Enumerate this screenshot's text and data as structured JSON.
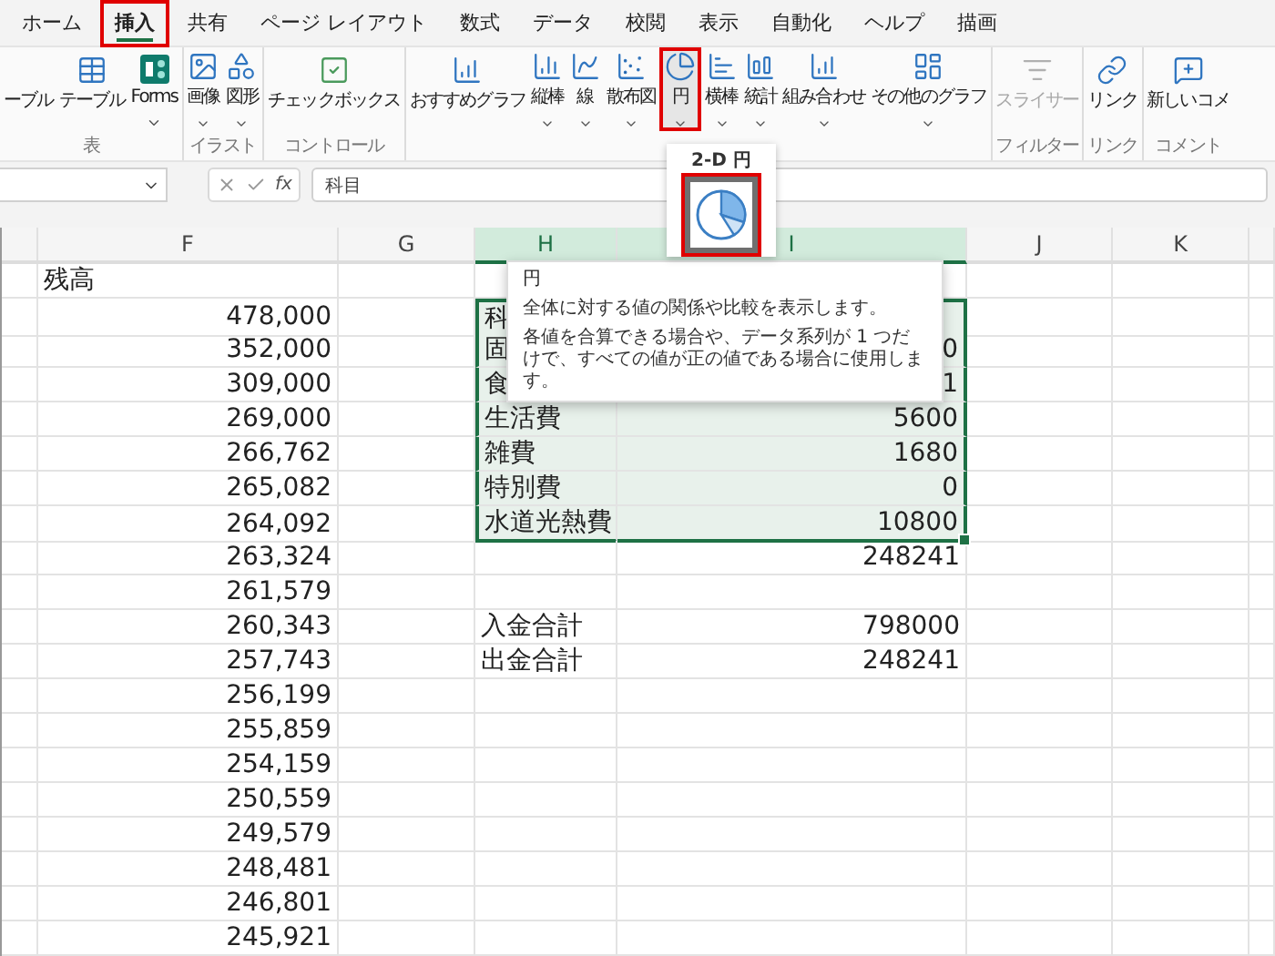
{
  "menu_tabs": [
    {
      "label": "ホーム",
      "selected": false,
      "highlighted": false
    },
    {
      "label": "挿入",
      "selected": true,
      "highlighted": true
    },
    {
      "label": "共有",
      "selected": false,
      "highlighted": false
    },
    {
      "label": "ページ レイアウト",
      "selected": false,
      "highlighted": false
    },
    {
      "label": "数式",
      "selected": false,
      "highlighted": false
    },
    {
      "label": "データ",
      "selected": false,
      "highlighted": false
    },
    {
      "label": "校閲",
      "selected": false,
      "highlighted": false
    },
    {
      "label": "表示",
      "selected": false,
      "highlighted": false
    },
    {
      "label": "自動化",
      "selected": false,
      "highlighted": false
    },
    {
      "label": "ヘルプ",
      "selected": false,
      "highlighted": false
    },
    {
      "label": "描画",
      "selected": false,
      "highlighted": false
    }
  ],
  "ribbon": {
    "groups": [
      {
        "label": "表",
        "buttons": [
          {
            "label": "ーブル",
            "kind": "plain",
            "dropdown": false,
            "highlighted": false,
            "disabled": false
          },
          {
            "label": "テーブル",
            "kind": "table",
            "dropdown": false,
            "highlighted": false,
            "disabled": false
          },
          {
            "label": "Forms",
            "kind": "forms",
            "dropdown": true,
            "highlighted": false,
            "disabled": false
          }
        ]
      },
      {
        "label": "イラスト",
        "buttons": [
          {
            "label": "画像",
            "kind": "image",
            "dropdown": true,
            "highlighted": false,
            "disabled": false
          },
          {
            "label": "図形",
            "kind": "shapes",
            "dropdown": true,
            "highlighted": false,
            "disabled": false
          }
        ]
      },
      {
        "label": "コントロール",
        "buttons": [
          {
            "label": "チェックボックス",
            "kind": "checkbox",
            "dropdown": false,
            "highlighted": false,
            "disabled": false
          }
        ]
      },
      {
        "buttons": [
          {
            "label": "おすすめグラフ",
            "kind": "recommended",
            "dropdown": false,
            "highlighted": false,
            "disabled": false
          },
          {
            "label": "縦棒",
            "kind": "column",
            "dropdown": true,
            "highlighted": false,
            "disabled": false
          },
          {
            "label": "線",
            "kind": "line",
            "dropdown": true,
            "highlighted": false,
            "disabled": false
          },
          {
            "label": "散布図",
            "kind": "scatter",
            "dropdown": true,
            "highlighted": false,
            "disabled": false
          },
          {
            "label": "円",
            "kind": "pie",
            "dropdown": true,
            "highlighted": true,
            "disabled": false
          },
          {
            "label": "横棒",
            "kind": "bar",
            "dropdown": true,
            "highlighted": false,
            "disabled": false
          },
          {
            "label": "統計",
            "kind": "stats",
            "dropdown": true,
            "highlighted": false,
            "disabled": false
          },
          {
            "label": "組み合わせ",
            "kind": "combo",
            "dropdown": true,
            "highlighted": false,
            "disabled": false
          },
          {
            "label": "その他のグラフ",
            "kind": "other",
            "dropdown": true,
            "highlighted": false,
            "disabled": false
          }
        ]
      },
      {
        "label": "フィルター",
        "buttons": [
          {
            "label": "スライサー",
            "kind": "slicer",
            "dropdown": false,
            "highlighted": false,
            "disabled": true
          }
        ]
      },
      {
        "label": "リンク",
        "buttons": [
          {
            "label": "リンク",
            "kind": "link",
            "dropdown": false,
            "highlighted": false,
            "disabled": false
          }
        ]
      },
      {
        "label": "コメント",
        "buttons": [
          {
            "label": "新しいコメ",
            "kind": "comment",
            "dropdown": false,
            "highlighted": false,
            "disabled": false
          }
        ]
      }
    ]
  },
  "formula_bar": {
    "function_label": "fx",
    "value": "科目"
  },
  "chart_menu": {
    "heading": "2-D 円",
    "options": [
      {
        "kind": "pie",
        "highlighted": true
      }
    ]
  },
  "tooltip": {
    "title": "円",
    "paragraphs": [
      "全体に対する値の関係や比較を表示します。",
      "各値を合算できる場合や、データ系列が 1 つだけで、すべての値が正の値である場合に使用します。"
    ]
  },
  "columns": [
    {
      "label": "F",
      "selected": false
    },
    {
      "label": "G",
      "selected": false
    },
    {
      "label": "H",
      "selected": true
    },
    {
      "label": "I",
      "selected": true
    },
    {
      "label": "J",
      "selected": false
    },
    {
      "label": "K",
      "selected": false
    }
  ],
  "rows": [
    {
      "in_selection": false,
      "F": {
        "text": "残高",
        "numeric": false
      }
    },
    {
      "in_selection": true,
      "F": {
        "text": "478,000",
        "numeric": true
      },
      "H": {
        "text": "科",
        "numeric": false
      }
    },
    {
      "in_selection": true,
      "F": {
        "text": "352,000",
        "numeric": true
      },
      "H": {
        "text": "固",
        "numeric": false
      },
      "I": {
        "text": "0",
        "numeric": true
      }
    },
    {
      "in_selection": true,
      "F": {
        "text": "309,000",
        "numeric": true
      },
      "H": {
        "text": "食",
        "numeric": false
      },
      "I": {
        "text": "1",
        "numeric": true
      }
    },
    {
      "in_selection": true,
      "F": {
        "text": "269,000",
        "numeric": true
      },
      "H": {
        "text": "生活費",
        "numeric": false
      },
      "I": {
        "text": "5600",
        "numeric": true
      }
    },
    {
      "in_selection": true,
      "F": {
        "text": "266,762",
        "numeric": true
      },
      "H": {
        "text": "雑費",
        "numeric": false
      },
      "I": {
        "text": "1680",
        "numeric": true
      }
    },
    {
      "in_selection": true,
      "F": {
        "text": "265,082",
        "numeric": true
      },
      "H": {
        "text": "特別費",
        "numeric": false
      },
      "I": {
        "text": "0",
        "numeric": true
      }
    },
    {
      "in_selection": true,
      "F": {
        "text": "264,092",
        "numeric": true
      },
      "H": {
        "text": "水道光熱費",
        "numeric": false
      },
      "I": {
        "text": "10800",
        "numeric": true
      }
    },
    {
      "in_selection": false,
      "F": {
        "text": "263,324",
        "numeric": true
      },
      "I": {
        "text": "248241",
        "numeric": true
      }
    },
    {
      "in_selection": false,
      "F": {
        "text": "261,579",
        "numeric": true
      }
    },
    {
      "in_selection": false,
      "F": {
        "text": "260,343",
        "numeric": true
      },
      "H": {
        "text": "入金合計",
        "numeric": false
      },
      "I": {
        "text": "798000",
        "numeric": true
      }
    },
    {
      "in_selection": false,
      "F": {
        "text": "257,743",
        "numeric": true
      },
      "H": {
        "text": "出金合計",
        "numeric": false
      },
      "I": {
        "text": "248241",
        "numeric": true
      }
    },
    {
      "in_selection": false,
      "F": {
        "text": "256,199",
        "numeric": true
      }
    },
    {
      "in_selection": false,
      "F": {
        "text": "255,859",
        "numeric": true
      }
    },
    {
      "in_selection": false,
      "F": {
        "text": "254,159",
        "numeric": true
      }
    },
    {
      "in_selection": false,
      "F": {
        "text": "250,559",
        "numeric": true
      }
    },
    {
      "in_selection": false,
      "F": {
        "text": "249,579",
        "numeric": true
      }
    },
    {
      "in_selection": false,
      "F": {
        "text": "248,481",
        "numeric": true
      }
    },
    {
      "in_selection": false,
      "F": {
        "text": "246,801",
        "numeric": true
      }
    },
    {
      "in_selection": false,
      "F": {
        "text": "245,921",
        "numeric": true
      }
    }
  ]
}
